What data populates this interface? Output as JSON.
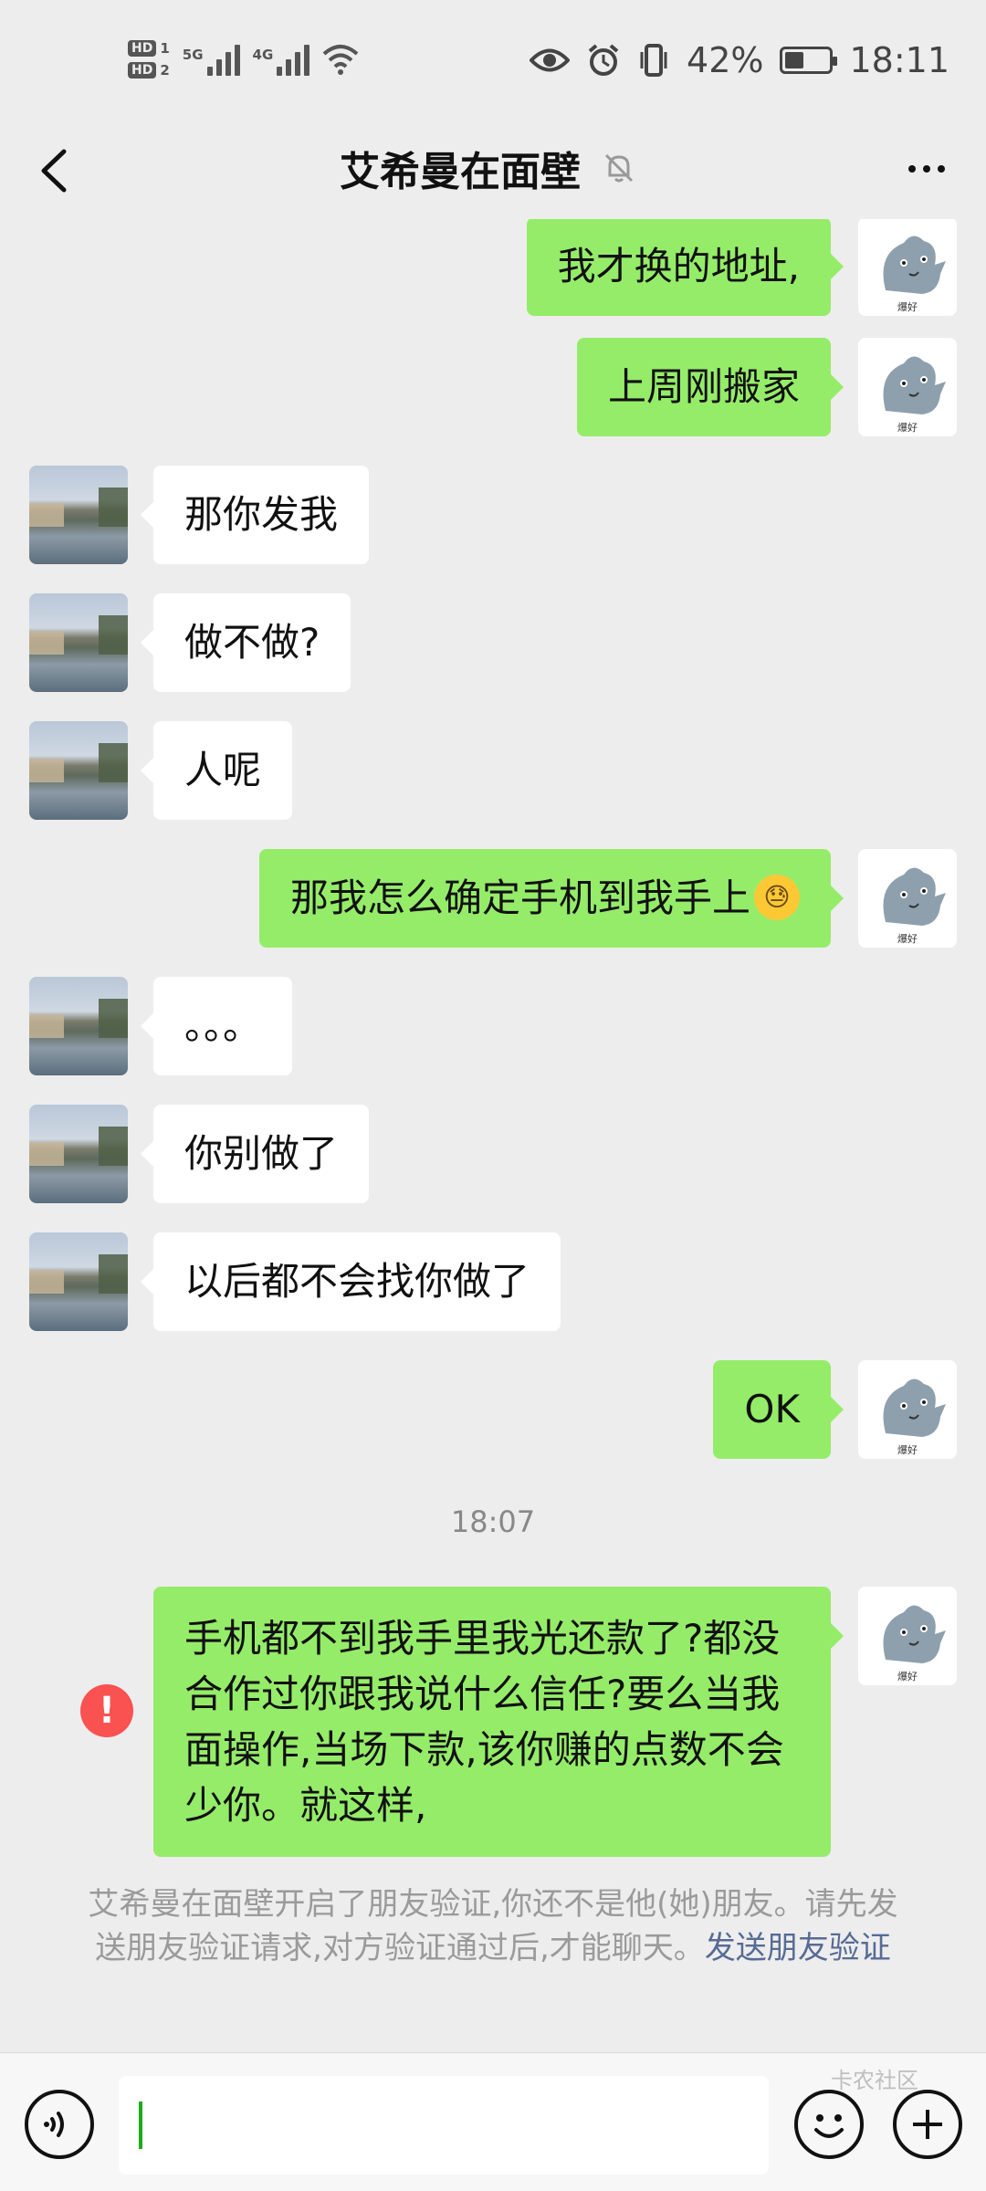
{
  "status_bar": {
    "sim1": "HD",
    "sim1_slot": "1",
    "sim2": "HD",
    "sim2_slot": "2",
    "net1": "5G",
    "net2": "4G",
    "battery": "42%",
    "battery_level": 0.42,
    "time": "18:11",
    "icons": [
      "eye-icon",
      "alarm-icon",
      "vibrate-icon",
      "wifi-icon"
    ]
  },
  "header": {
    "title": "艾希曼在面壁",
    "muted": true
  },
  "messages": [
    {
      "side": "right",
      "text": "我才换的地址,",
      "avatar": "sticker",
      "sticker_label": "爆好"
    },
    {
      "side": "right",
      "text": "上周刚搬家",
      "avatar": "sticker",
      "sticker_label": "爆好"
    },
    {
      "side": "left",
      "text": "那你发我",
      "avatar": "photo"
    },
    {
      "side": "left",
      "text": "做不做?",
      "avatar": "photo"
    },
    {
      "side": "left",
      "text": "人呢",
      "avatar": "photo"
    },
    {
      "side": "right",
      "text": "那我怎么确定手机到我手上",
      "emoji": "😓",
      "avatar": "sticker",
      "sticker_label": "爆好"
    },
    {
      "side": "left",
      "text": "。。。",
      "avatar": "photo"
    },
    {
      "side": "left",
      "text": "你别做了",
      "avatar": "photo"
    },
    {
      "side": "left",
      "text": "以后都不会找你做了",
      "avatar": "photo"
    },
    {
      "side": "right",
      "text": "OK",
      "avatar": "sticker",
      "sticker_label": "爆好"
    }
  ],
  "timestamp": "18:07",
  "failed_message": {
    "text": "手机都不到我手里我光还款了?都没合作过你跟我说什么信任?要么当我面操作,当场下款,该你赚的点数不会少你。就这样,",
    "error_icon": "!",
    "sticker_label": "爆好"
  },
  "system_notice": {
    "text": "艾希曼在面壁开启了朋友验证,你还不是他(她)朋友。请先发送朋友验证请求,对方验证通过后,才能聊天。",
    "link": "发送朋友验证"
  },
  "input_bar": {
    "value": "",
    "icons": [
      "voice-icon",
      "emoji-icon",
      "plus-icon"
    ]
  },
  "watermark": "卡农社区"
}
